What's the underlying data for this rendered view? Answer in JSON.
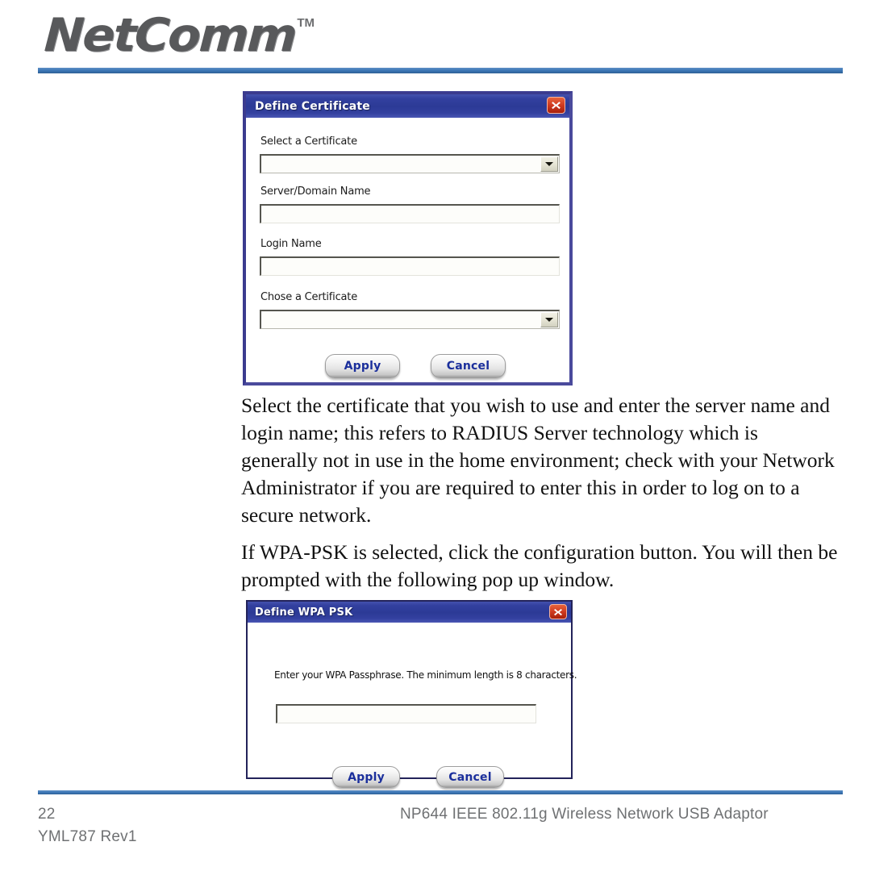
{
  "header": {
    "logo_text": "NetComm",
    "trademark": "TM"
  },
  "dialog_certificate": {
    "title": "Define Certificate",
    "close_icon": "close-icon",
    "fields": [
      {
        "label": "Select a Certificate",
        "type": "combobox",
        "value": ""
      },
      {
        "label": "Server/Domain Name",
        "type": "text",
        "value": ""
      },
      {
        "label": "Login Name",
        "type": "text",
        "value": ""
      },
      {
        "label": "Chose a Certificate",
        "type": "combobox",
        "value": ""
      }
    ],
    "buttons": {
      "apply": "Apply",
      "cancel": "Cancel"
    }
  },
  "body": {
    "paragraph_1": "Select the certificate that you wish to use and enter the server name and login name; this refers to RADIUS Server technology which is generally not in use in the home environment; check with your Network Administrator if you are required to enter this in order to log on to a secure network.",
    "paragraph_2": "If WPA-PSK is selected, click the configuration button.  You will then be prompted with the following pop up window."
  },
  "dialog_wpa_psk": {
    "title": "Define WPA PSK",
    "close_icon": "close-icon",
    "prompt": "Enter your WPA Passphrase.  The minimum length is 8 characters.",
    "passphrase_value": "",
    "buttons": {
      "apply": "Apply",
      "cancel": "Cancel"
    }
  },
  "footer": {
    "page_number": "22",
    "revision": "YML787 Rev1",
    "model": "NP644 IEEE 802.11g  Wireless Network USB Adaptor"
  },
  "colors": {
    "brand_blue": "#3d78b8",
    "titlebar_blue": "#2c3a96",
    "dialog_border": "#3b3b8f",
    "close_red": "#cf3a20",
    "button_text_blue": "#1b2f9c",
    "footer_gray": "#6f7173"
  }
}
